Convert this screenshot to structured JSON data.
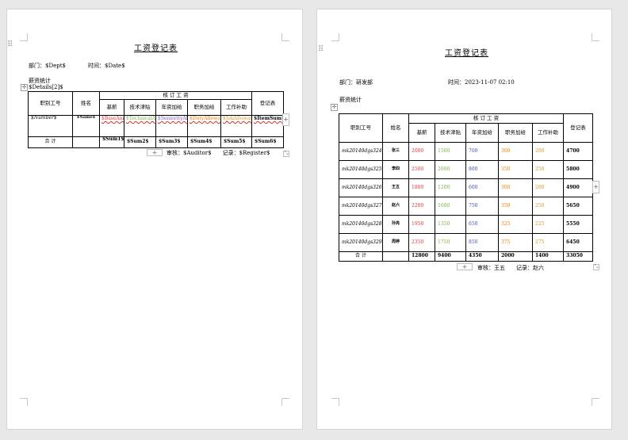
{
  "left": {
    "title": "工资登记表",
    "dept": "部门：$Dept$",
    "time": "时间：$Date$",
    "section": "薪资统计",
    "details_tag": "$Details[2]$",
    "headers": {
      "id": "职别工号",
      "name": "姓名",
      "group": "核 订 工 资",
      "base": "基薪",
      "tech": "技术津贴",
      "seniority": "年资加给",
      "duty": "职务加给",
      "job": "工作补助",
      "total": "登记表"
    },
    "row": {
      "id": "$Number$",
      "name": "$Name$",
      "base": "$BaseAmount$",
      "tech": "$TechnicalAllowance$",
      "seniority": "$SeniorityAllowance$",
      "duty": "$DutyAllowance$",
      "job": "$JobAllowance$",
      "item": "$ItemSum$"
    },
    "sum_row": {
      "label": "合 计",
      "s1": "$Sum1$",
      "s2": "$Sum2$",
      "s3": "$Sum3$",
      "s4": "$Sum4$",
      "s5": "$Sum5$",
      "s6": "$Sum6$"
    },
    "signature": "审核：$Auditor$　　记录：$Register$"
  },
  "right": {
    "title": "工资登记表",
    "dept": "部门：研发部",
    "time": "时间：2023-11-07 02:10",
    "section": "薪资统计",
    "headers": {
      "id": "职别工号",
      "name": "姓名",
      "group": "核 订 工 资",
      "base": "基薪",
      "tech": "技术津贴",
      "seniority": "年资加给",
      "duty": "职务加给",
      "job": "工作补助",
      "total": "登记表"
    },
    "rows": [
      {
        "id": "mk20140dgs324",
        "name": "张三",
        "base": "2000",
        "tech": "1500",
        "seniority": "700",
        "duty": "300",
        "job": "200",
        "total": "4700"
      },
      {
        "id": "mk20140dgs325",
        "name": "李四",
        "base": "2500",
        "tech": "2000",
        "seniority": "800",
        "duty": "350",
        "job": "250",
        "total": "5800"
      },
      {
        "id": "mk20140dgs326",
        "name": "王五",
        "base": "1800",
        "tech": "1200",
        "seniority": "600",
        "duty": "300",
        "job": "200",
        "total": "4900"
      },
      {
        "id": "mk20140dgs327",
        "name": "赵六",
        "base": "2200",
        "tech": "1600",
        "seniority": "750",
        "duty": "350",
        "job": "250",
        "total": "5650"
      },
      {
        "id": "mk20140dgs328",
        "name": "孙亮",
        "base": "1950",
        "tech": "1350",
        "seniority": "650",
        "duty": "325",
        "job": "225",
        "total": "5550"
      },
      {
        "id": "mk20140dgs329",
        "name": "周婷",
        "base": "2350",
        "tech": "1750",
        "seniority": "850",
        "duty": "375",
        "job": "275",
        "total": "6450"
      }
    ],
    "sum_row": {
      "label": "合 计",
      "s1": "12800",
      "s2": "9400",
      "s3": "4350",
      "s4": "2000",
      "s5": "1400",
      "s6": "33050"
    },
    "signature": "审核：王五　　记录：赵六"
  },
  "colors": {
    "base": "#e53935",
    "tech": "#7cb342",
    "seniority": "#3f51b5",
    "duty": "#f57c00",
    "job": "#c99a28"
  },
  "icons": [
    "drag-handle-icon",
    "table-move-icon",
    "add-row-icon",
    "resize-handle-icon"
  ]
}
